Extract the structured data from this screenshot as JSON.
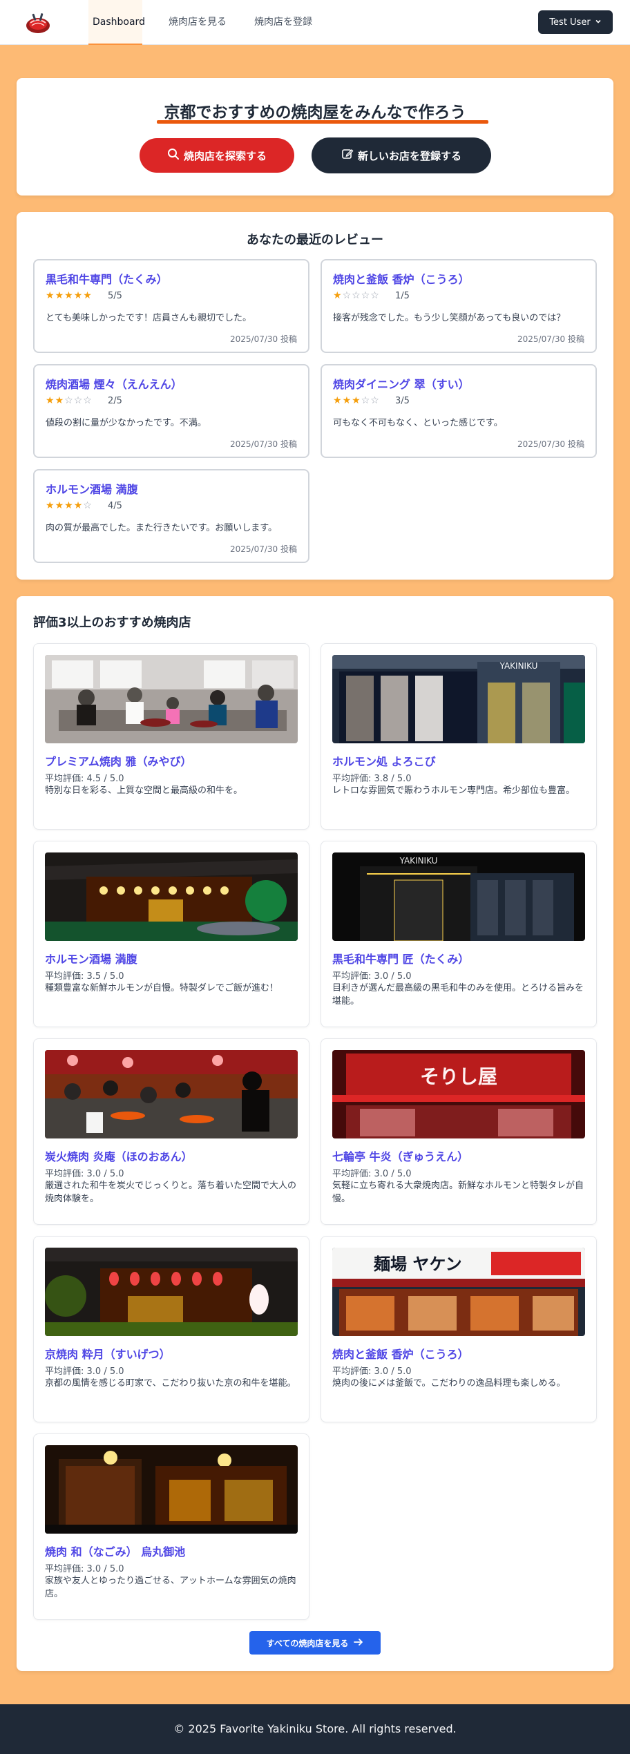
{
  "nav": {
    "items": [
      {
        "label": "Dashboard"
      },
      {
        "label": "焼肉店を見る"
      },
      {
        "label": "焼肉店を登録"
      }
    ],
    "user_label": "Test User"
  },
  "hero": {
    "title": "京都でおすすめの焼肉屋をみんなで作ろう",
    "search_button": "焼肉店を探索する",
    "register_button": "新しいお店を登録する"
  },
  "reviews": {
    "title": "あなたの最近のレビュー",
    "items": [
      {
        "shop": "黒毛和牛専門（たくみ）",
        "stars": 5,
        "rating": "5/5",
        "comment": "とても美味しかったです！店員さんも親切でした。",
        "date": "2025/07/30 投稿"
      },
      {
        "shop": "焼肉と釜飯 香炉（こうろ）",
        "stars": 1,
        "rating": "1/5",
        "comment": "接客が残念でした。もう少し笑顔があっても良いのでは？",
        "date": "2025/07/30 投稿"
      },
      {
        "shop": "焼肉酒場 煙々（えんえん）",
        "stars": 2,
        "rating": "2/5",
        "comment": "値段の割に量が少なかったです。不満。",
        "date": "2025/07/30 投稿"
      },
      {
        "shop": "焼肉ダイニング 翠（すい）",
        "stars": 3,
        "rating": "3/5",
        "comment": "可もなく不可もなく、といった感じです。",
        "date": "2025/07/30 投稿"
      },
      {
        "shop": "ホルモン酒場 満腹",
        "stars": 4,
        "rating": "4/5",
        "comment": "肉の質が最高でした。また行きたいです。お願いします。",
        "date": "2025/07/30 投稿"
      }
    ]
  },
  "recommend": {
    "title": "評価3以上のおすすめ焼肉店",
    "shops": [
      {
        "name": "プレミアム焼肉 雅（みやび）",
        "avg": "平均評価: 4.5 / 5.0",
        "desc": "特別な日を彩る、上質な空間と最高級の和牛を。",
        "image": "family-dining-photo"
      },
      {
        "name": "ホルモン処 よろこび",
        "avg": "平均評価: 3.8 / 5.0",
        "desc": "レトロな雰囲気で賑わうホルモン専門店。希少部位も豊富。",
        "image": "modern-storefront-photo",
        "sign": "YAKINIKU"
      },
      {
        "name": "ホルモン酒場 満腹",
        "avg": "平均評価: 3.5 / 5.0",
        "desc": "種類豊富な新鮮ホルモンが自慢。特製ダレでご飯が進む！",
        "image": "japanese-house-photo"
      },
      {
        "name": "黒毛和牛専門 匠（たくみ）",
        "avg": "平均評価: 3.0 / 5.0",
        "desc": "目利きが選んだ最高級の黒毛和牛のみを使用。とろける旨みを堪能。",
        "image": "dark-storefront-photo",
        "sign": "YAKINIKU"
      },
      {
        "name": "炭火焼肉 炎庵（ほのおあん）",
        "avg": "平均評価: 3.0 / 5.0",
        "desc": "厳選された和牛を炭火でじっくりと。落ち着いた空間で大人の焼肉体験を。",
        "image": "busy-restaurant-photo"
      },
      {
        "name": "七輪亭 牛炎（ぎゅうえん）",
        "avg": "平均評価: 3.0 / 5.0",
        "desc": "気軽に立ち寄れる大衆焼肉店。新鮮なホルモンと特製タレが自慢。",
        "image": "red-sign-storefront-photo",
        "sign": "そりし屋"
      },
      {
        "name": "京焼肉 粋月（すいげつ）",
        "avg": "平均評価: 3.0 / 5.0",
        "desc": "京都の風情を感じる町家で、こだわり抜いた京の和牛を堪能。",
        "image": "lantern-machiya-photo"
      },
      {
        "name": "焼肉と釜飯 香炉（こうろ）",
        "avg": "平均評価: 3.0 / 5.0",
        "desc": "焼肉の後に〆は釜飯で。こだわりの逸品料理も楽しめる。",
        "image": "neon-street-photo",
        "sign": "麺場 ヤケン"
      },
      {
        "name": "焼肉 和（なごみ） 烏丸御池",
        "avg": "平均評価: 3.0 / 5.0",
        "desc": "家族や友人とゆったり過ごせる、アットホームな雰囲気の焼肉店。",
        "image": "warm-interior-photo"
      }
    ],
    "all_button": "すべての焼肉店を見る"
  },
  "footer": {
    "text": "© 2025 Favorite Yakiniku Store. All rights reserved."
  },
  "colors": {
    "page_bg": "#fdba74",
    "accent_red": "#dc2626",
    "dark": "#1f2937",
    "link": "#4f46e5",
    "star": "#f59e0b",
    "primary_blue": "#2563eb"
  }
}
